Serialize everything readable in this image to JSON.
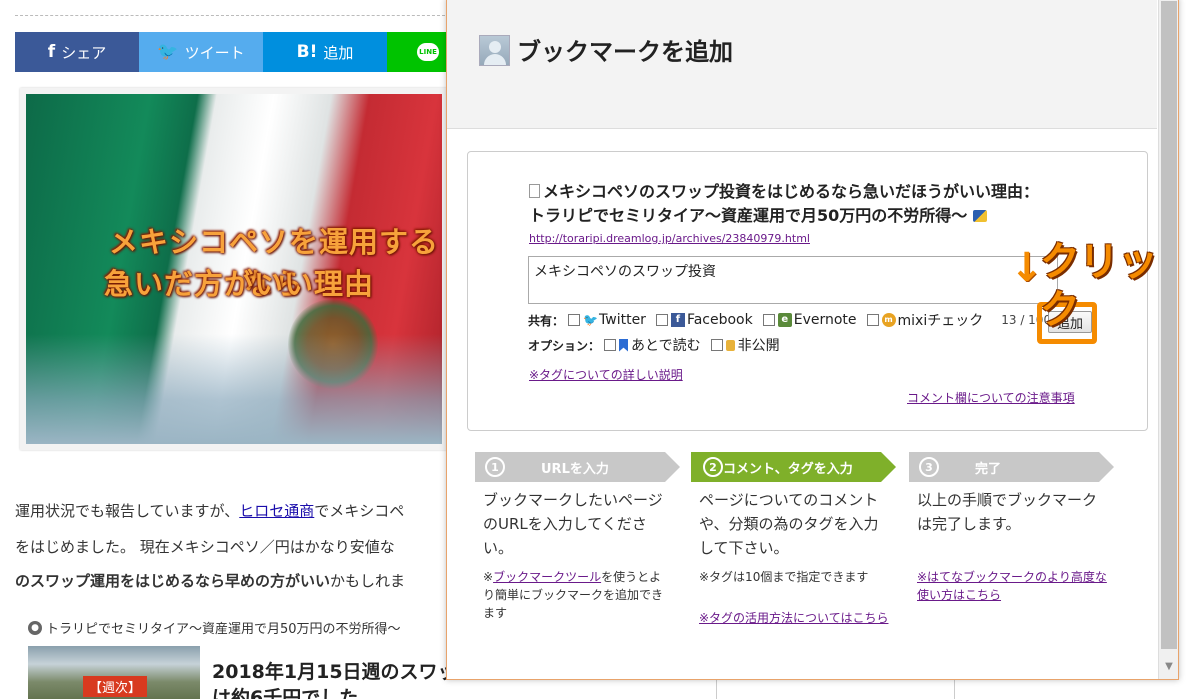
{
  "blog": {
    "share": {
      "facebook": "シェア",
      "twitter": "ツイート",
      "hatena_glyph": "B!",
      "hatena": "追加",
      "line": "LINE"
    },
    "hero": {
      "caption_line1": "メキシコペソを運用するなら",
      "caption_line2": "急いだ方がいい理由"
    },
    "paragraph1_pre": "運用状況でも報告していますが、",
    "paragraph1_link": "ヒロセ通商",
    "paragraph1_post": "でメキシコペ",
    "paragraph2": "をはじめました。 現在メキシコペソ／円はかなり安値な",
    "paragraph3_bold": "のスワップ運用をはじめるなら早めの方がいい",
    "paragraph3_normal": "かもしれま",
    "related_heading": "トラリピでセミリタイア〜資産運用で月50万円の不労所得〜",
    "related_thumb_tag": "【週次】",
    "related_title_line1": "2018年1月15日週のスワップ",
    "related_title_line2": "は約6千円でした"
  },
  "popup": {
    "title": "ブックマークを追加",
    "entry_title_line1": "メキシコペソのスワップ投資をはじめるなら急いだほうがいい理由：",
    "entry_title_line2": "トラリピでセミリタイア〜資産運用で月50万円の不労所得〜",
    "entry_url": "http://toraripi.dreamlog.jp/archives/23840979.html",
    "comment_value": "メキシコペソのスワップ投資",
    "share_label": "共有：",
    "services": [
      "Twitter",
      "Facebook",
      "Evernote",
      "mixiチェック"
    ],
    "counter": "13 / 100",
    "add_button": "追加",
    "option_label": "オプション：",
    "options": [
      "あとで読む",
      "非公開"
    ],
    "tag_help_link": "※タグについての詳しい説明",
    "comment_note_link": "コメント欄についての注意事項",
    "steps": [
      {
        "num": "1",
        "label": "URLを入力",
        "text": "ブックマークしたいページのURLを入力してください。"
      },
      {
        "num": "2",
        "label": "コメント、タグを入力",
        "text": "ページについてのコメントや、分類の為のタグを入力して下さい。"
      },
      {
        "num": "3",
        "label": "完了",
        "text": "以上の手順でブックマークは完了します。"
      }
    ],
    "note1_prefix": "※",
    "note1_link": "ブックマークツール",
    "note1_suffix": "を使うとより簡単にブックマークを追加できます",
    "note2a": "※タグは10個まで指定できます",
    "note2b_link": "※タグの活用方法についてはこちら",
    "note3_link": "※はてなブックマークのより高度な使い方はこちら"
  },
  "annotation": {
    "arrow": "↓",
    "text": "クリック",
    "color": "#f58b00"
  }
}
